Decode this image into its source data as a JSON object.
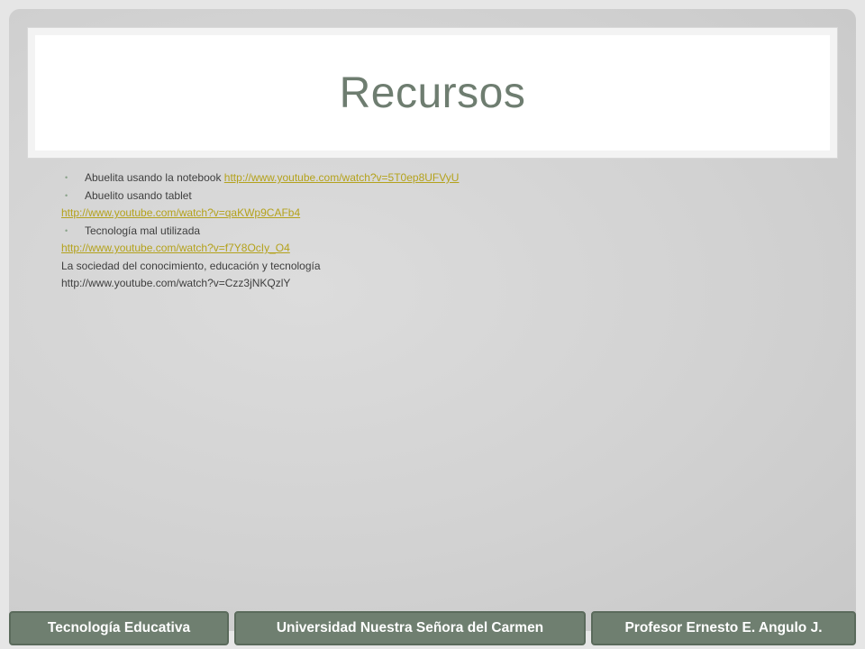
{
  "slide": {
    "title": "Recursos",
    "items": [
      {
        "type": "bullet",
        "text": "Abuelita usando la notebook ",
        "link": "http://www.youtube.com/watch?v=5T0ep8UFVyU"
      },
      {
        "type": "bullet",
        "text": "Abuelito usando tablet",
        "link": ""
      },
      {
        "type": "line",
        "text": "",
        "link": "http://www.youtube.com/watch?v=qaKWp9CAFb4"
      },
      {
        "type": "bullet",
        "text": "Tecnología mal utilizada",
        "link": ""
      },
      {
        "type": "line",
        "text": "",
        "link": "http://www.youtube.com/watch?v=f7Y8OcIy_O4"
      },
      {
        "type": "line",
        "text": "La sociedad del conocimiento, educación y tecnología",
        "link": ""
      },
      {
        "type": "line",
        "text": "http://www.youtube.com/watch?v=Czz3jNKQzlY",
        "link": ""
      }
    ]
  },
  "footer": {
    "left": "Tecnología Educativa",
    "center": "Universidad Nuestra Señora del Carmen",
    "right": "Profesor Ernesto E. Angulo J."
  },
  "colors": {
    "title": "#6e7d70",
    "link": "#b4a21c",
    "footer_bg": "#6f7f70",
    "bullet": "#8aa38a"
  }
}
